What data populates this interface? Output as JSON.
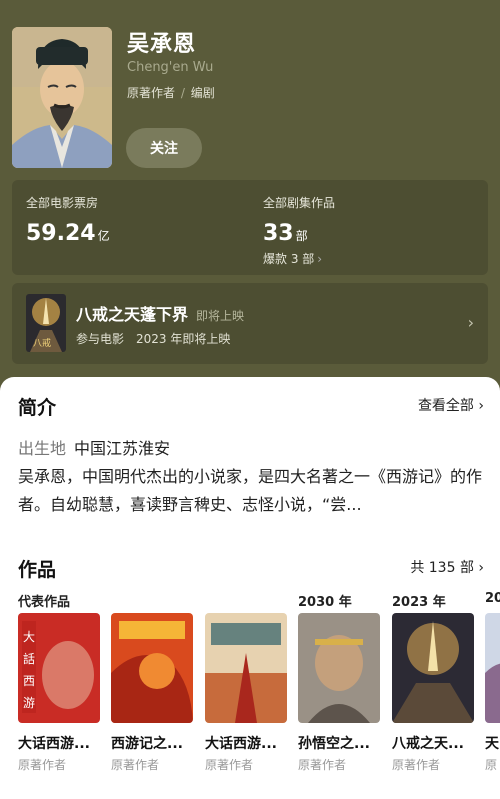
{
  "person": {
    "name": "吴承恩",
    "name_en": "Cheng'en Wu",
    "role1": "原著作者",
    "role_sep": "/",
    "role2": "编剧",
    "follow_label": "关注"
  },
  "stats": {
    "box_office_label": "全部电影票房",
    "box_office_value": "59.24",
    "box_office_unit": "亿",
    "series_label": "全部剧集作品",
    "series_value": "33",
    "series_unit": "部",
    "hits_label": "爆款 3 部",
    "hits_chevron": "›"
  },
  "upcoming": {
    "title": "八戒之天蓬下界",
    "status": "即将上映",
    "role": "参与电影",
    "release": "2023 年即将上映",
    "chevron": "›"
  },
  "intro": {
    "title": "简介",
    "view_all": "查看全部 ›",
    "birth_key": "出生地",
    "birth_value": "中国江苏淮安",
    "text": "吴承恩，中国明代杰出的小说家，是四大名著之一《西游记》的作者。自幼聪慧，喜读野言稗史、志怪小说，“尝..."
  },
  "works": {
    "title": "作品",
    "count": "共 135 部 ›",
    "rep_label": "代表作品",
    "items": [
      {
        "year": "",
        "title": "大话西游...",
        "role": "原著作者"
      },
      {
        "year": "",
        "title": "西游记之...",
        "role": "原著作者"
      },
      {
        "year": "",
        "title": "大话西游...",
        "role": "原著作者"
      },
      {
        "year": "2030 年",
        "title": "孙悟空之...",
        "role": "原著作者"
      },
      {
        "year": "2023 年",
        "title": "八戒之天...",
        "role": "原著作者"
      },
      {
        "year": "20",
        "title": "天",
        "role": "原"
      }
    ]
  }
}
